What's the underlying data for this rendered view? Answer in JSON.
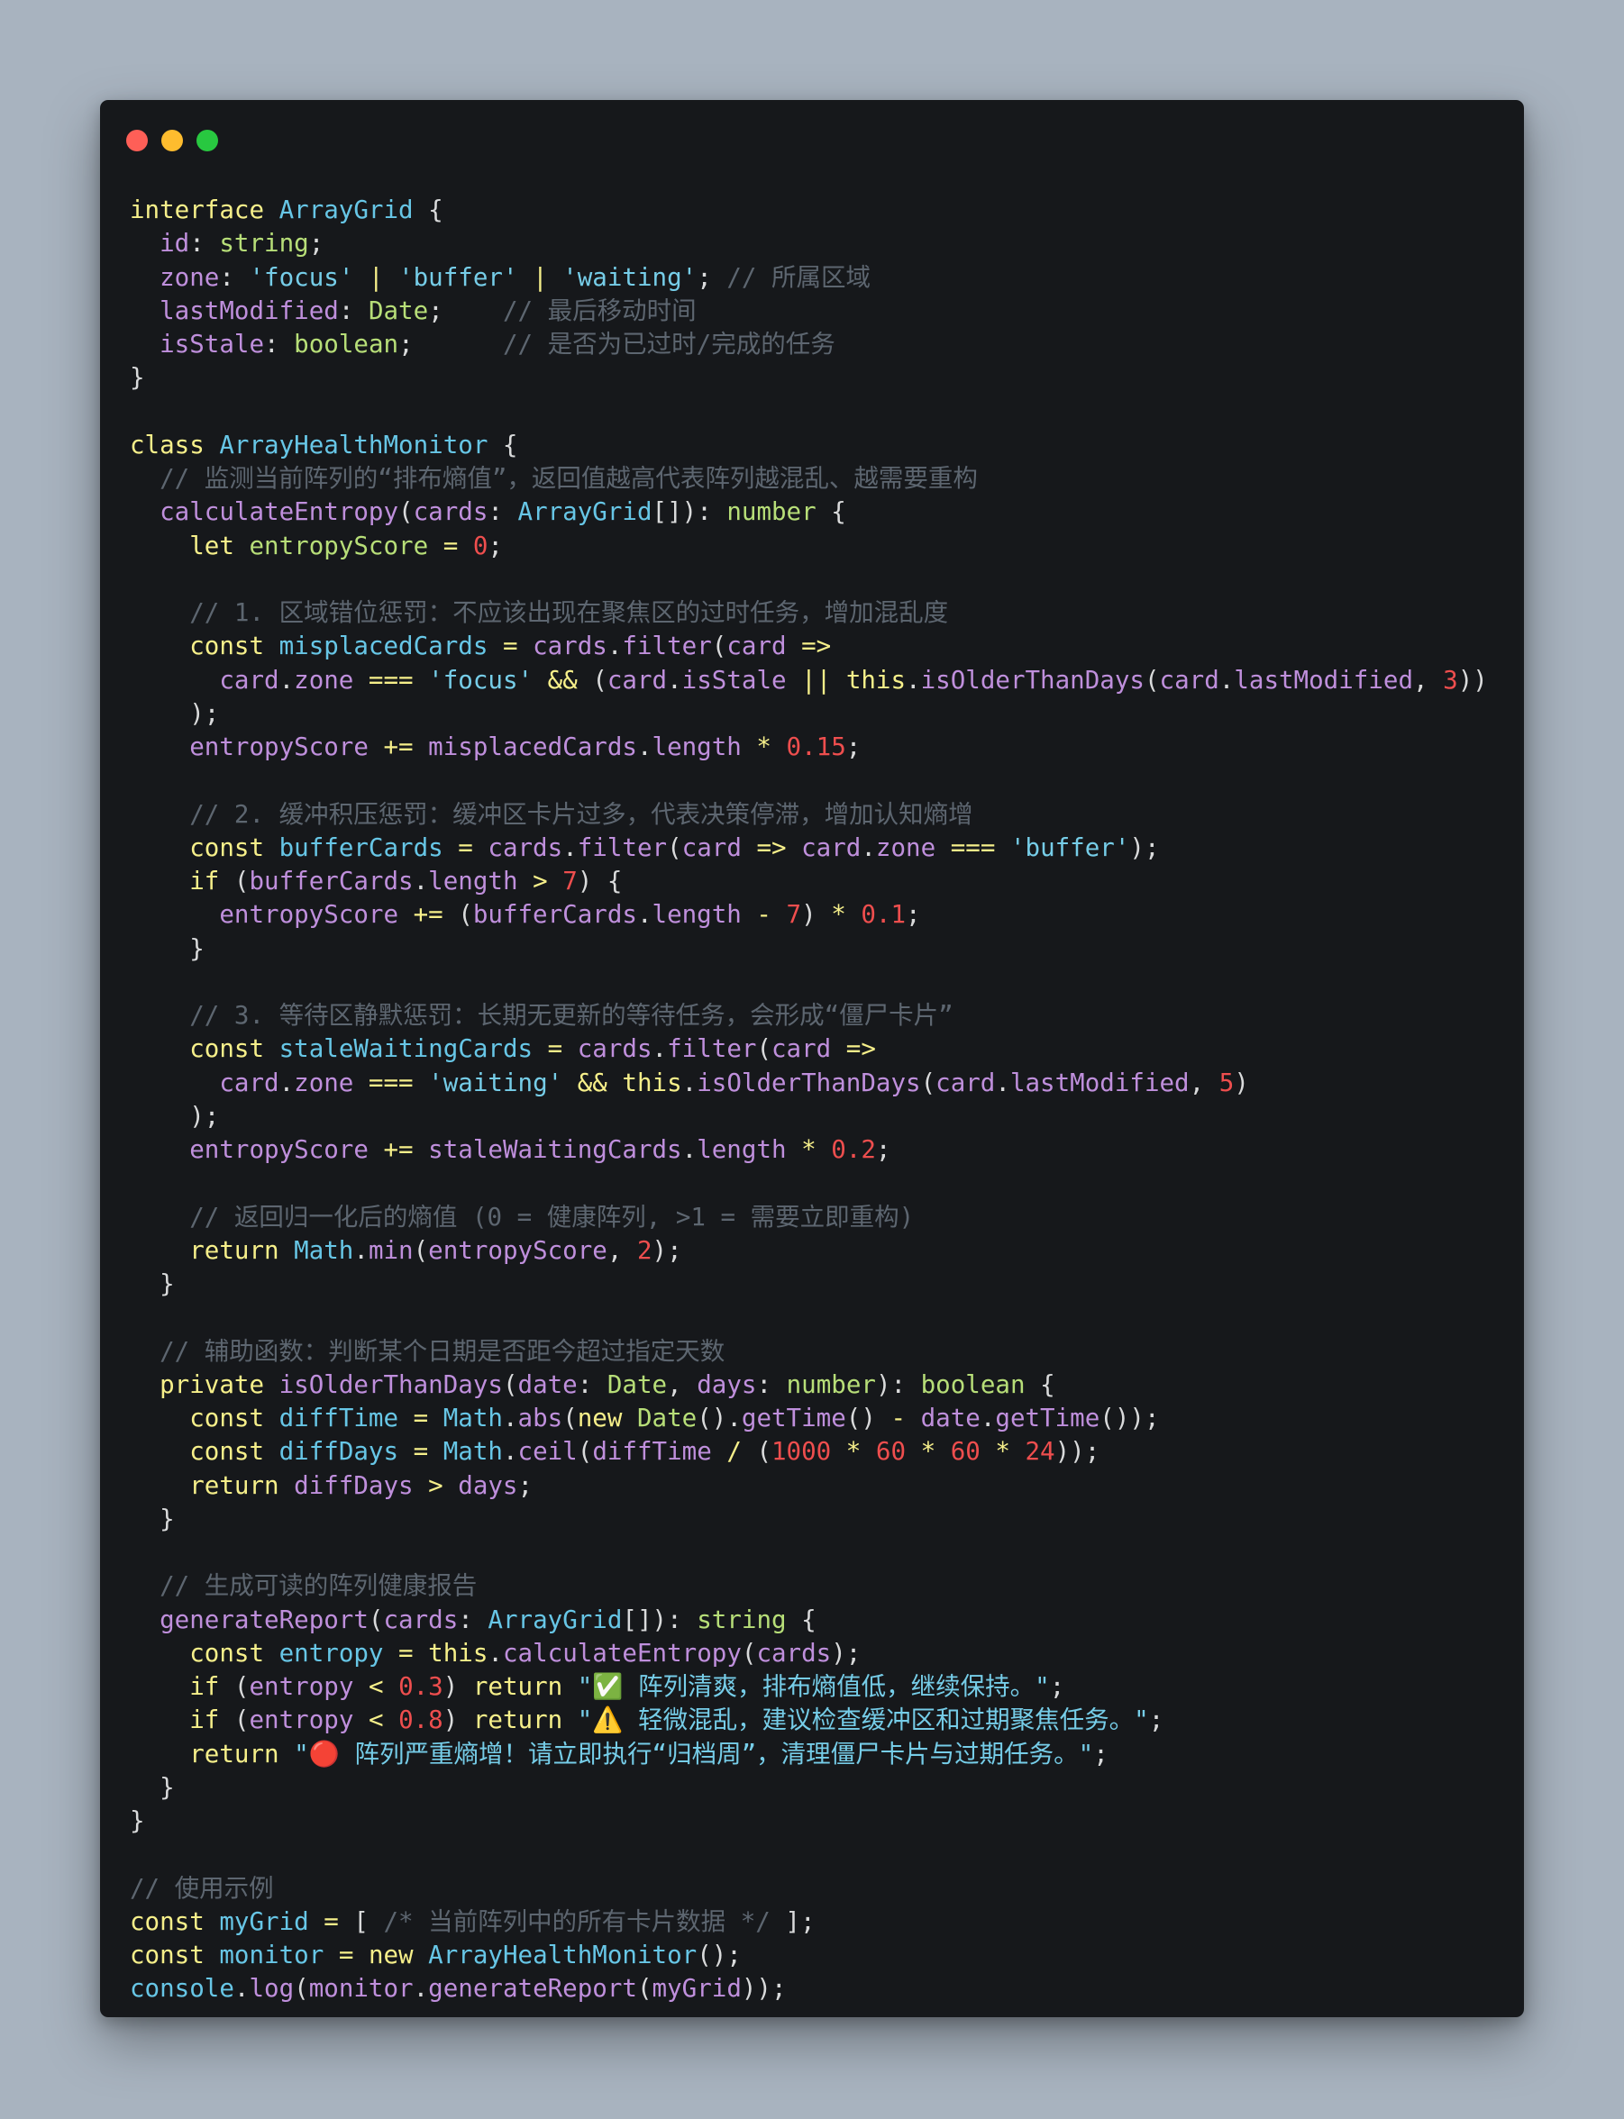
{
  "window": {
    "controls": [
      "close",
      "minimize",
      "maximize"
    ]
  },
  "code_lines": [
    [
      [
        "keyword",
        "interface"
      ],
      [
        "plain",
        " "
      ],
      [
        "type",
        "ArrayGrid"
      ],
      [
        "punct",
        " {"
      ]
    ],
    [
      [
        "plain",
        "  "
      ],
      [
        "prop",
        "id"
      ],
      [
        "punct",
        ": "
      ],
      [
        "prim",
        "string"
      ],
      [
        "punct",
        ";"
      ]
    ],
    [
      [
        "plain",
        "  "
      ],
      [
        "prop",
        "zone"
      ],
      [
        "punct",
        ": "
      ],
      [
        "string",
        "'focus'"
      ],
      [
        "operator",
        " | "
      ],
      [
        "string",
        "'buffer'"
      ],
      [
        "operator",
        " | "
      ],
      [
        "string",
        "'waiting'"
      ],
      [
        "punct",
        "; "
      ],
      [
        "comment",
        "// 所属区域"
      ]
    ],
    [
      [
        "plain",
        "  "
      ],
      [
        "prop",
        "lastModified"
      ],
      [
        "punct",
        ": "
      ],
      [
        "prim",
        "Date"
      ],
      [
        "punct",
        ";    "
      ],
      [
        "comment",
        "// 最后移动时间"
      ]
    ],
    [
      [
        "plain",
        "  "
      ],
      [
        "prop",
        "isStale"
      ],
      [
        "punct",
        ": "
      ],
      [
        "prim",
        "boolean"
      ],
      [
        "punct",
        ";      "
      ],
      [
        "comment",
        "// 是否为已过时/完成的任务"
      ]
    ],
    [
      [
        "punct",
        "}"
      ]
    ],
    [],
    [
      [
        "keyword",
        "class"
      ],
      [
        "plain",
        " "
      ],
      [
        "type",
        "ArrayHealthMonitor"
      ],
      [
        "punct",
        " {"
      ]
    ],
    [
      [
        "plain",
        "  "
      ],
      [
        "comment",
        "// 监测当前阵列的“排布熵值”，返回值越高代表阵列越混乱、越需要重构"
      ]
    ],
    [
      [
        "plain",
        "  "
      ],
      [
        "method",
        "calculateEntropy"
      ],
      [
        "punct",
        "("
      ],
      [
        "prop",
        "cards"
      ],
      [
        "punct",
        ": "
      ],
      [
        "type",
        "ArrayGrid"
      ],
      [
        "punct",
        "[]): "
      ],
      [
        "prim",
        "number"
      ],
      [
        "punct",
        " {"
      ]
    ],
    [
      [
        "plain",
        "    "
      ],
      [
        "keyword",
        "let"
      ],
      [
        "plain",
        " "
      ],
      [
        "prim",
        "entropyScore"
      ],
      [
        "operator",
        " = "
      ],
      [
        "number",
        "0"
      ],
      [
        "punct",
        ";"
      ]
    ],
    [],
    [
      [
        "plain",
        "    "
      ],
      [
        "comment",
        "// 1. 区域错位惩罚：不应该出现在聚焦区的过时任务，增加混乱度"
      ]
    ],
    [
      [
        "plain",
        "    "
      ],
      [
        "keyword",
        "const"
      ],
      [
        "plain",
        " "
      ],
      [
        "type",
        "misplacedCards"
      ],
      [
        "operator",
        " = "
      ],
      [
        "prop",
        "cards"
      ],
      [
        "punct",
        "."
      ],
      [
        "method",
        "filter"
      ],
      [
        "punct",
        "("
      ],
      [
        "prop",
        "card"
      ],
      [
        "operator",
        " =>"
      ]
    ],
    [
      [
        "plain",
        "      "
      ],
      [
        "prop",
        "card"
      ],
      [
        "punct",
        "."
      ],
      [
        "prop",
        "zone"
      ],
      [
        "operator",
        " === "
      ],
      [
        "string",
        "'focus'"
      ],
      [
        "operator",
        " && "
      ],
      [
        "punct",
        "("
      ],
      [
        "prop",
        "card"
      ],
      [
        "punct",
        "."
      ],
      [
        "prop",
        "isStale"
      ],
      [
        "operator",
        " || "
      ],
      [
        "keyword",
        "this"
      ],
      [
        "punct",
        "."
      ],
      [
        "method",
        "isOlderThanDays"
      ],
      [
        "punct",
        "("
      ],
      [
        "prop",
        "card"
      ],
      [
        "punct",
        "."
      ],
      [
        "prop",
        "lastModified"
      ],
      [
        "punct",
        ", "
      ],
      [
        "number",
        "3"
      ],
      [
        "punct",
        "))"
      ]
    ],
    [
      [
        "plain",
        "    "
      ],
      [
        "punct",
        ");"
      ]
    ],
    [
      [
        "plain",
        "    "
      ],
      [
        "prop",
        "entropyScore"
      ],
      [
        "operator",
        " += "
      ],
      [
        "prop",
        "misplacedCards"
      ],
      [
        "punct",
        "."
      ],
      [
        "prop",
        "length"
      ],
      [
        "operator",
        " * "
      ],
      [
        "number",
        "0.15"
      ],
      [
        "punct",
        ";"
      ]
    ],
    [],
    [
      [
        "plain",
        "    "
      ],
      [
        "comment",
        "// 2. 缓冲积压惩罚：缓冲区卡片过多，代表决策停滞，增加认知熵增"
      ]
    ],
    [
      [
        "plain",
        "    "
      ],
      [
        "keyword",
        "const"
      ],
      [
        "plain",
        " "
      ],
      [
        "type",
        "bufferCards"
      ],
      [
        "operator",
        " = "
      ],
      [
        "prop",
        "cards"
      ],
      [
        "punct",
        "."
      ],
      [
        "method",
        "filter"
      ],
      [
        "punct",
        "("
      ],
      [
        "prop",
        "card"
      ],
      [
        "operator",
        " => "
      ],
      [
        "prop",
        "card"
      ],
      [
        "punct",
        "."
      ],
      [
        "prop",
        "zone"
      ],
      [
        "operator",
        " === "
      ],
      [
        "string",
        "'buffer'"
      ],
      [
        "punct",
        ");"
      ]
    ],
    [
      [
        "plain",
        "    "
      ],
      [
        "keyword",
        "if"
      ],
      [
        "punct",
        " ("
      ],
      [
        "prop",
        "bufferCards"
      ],
      [
        "punct",
        "."
      ],
      [
        "prop",
        "length"
      ],
      [
        "operator",
        " > "
      ],
      [
        "number",
        "7"
      ],
      [
        "punct",
        ") {"
      ]
    ],
    [
      [
        "plain",
        "      "
      ],
      [
        "prop",
        "entropyScore"
      ],
      [
        "operator",
        " += "
      ],
      [
        "punct",
        "("
      ],
      [
        "prop",
        "bufferCards"
      ],
      [
        "punct",
        "."
      ],
      [
        "prop",
        "length"
      ],
      [
        "operator",
        " - "
      ],
      [
        "number",
        "7"
      ],
      [
        "punct",
        ")"
      ],
      [
        "operator",
        " * "
      ],
      [
        "number",
        "0.1"
      ],
      [
        "punct",
        ";"
      ]
    ],
    [
      [
        "plain",
        "    "
      ],
      [
        "punct",
        "}"
      ]
    ],
    [],
    [
      [
        "plain",
        "    "
      ],
      [
        "comment",
        "// 3. 等待区静默惩罚：长期无更新的等待任务，会形成“僵尸卡片”"
      ]
    ],
    [
      [
        "plain",
        "    "
      ],
      [
        "keyword",
        "const"
      ],
      [
        "plain",
        " "
      ],
      [
        "type",
        "staleWaitingCards"
      ],
      [
        "operator",
        " = "
      ],
      [
        "prop",
        "cards"
      ],
      [
        "punct",
        "."
      ],
      [
        "method",
        "filter"
      ],
      [
        "punct",
        "("
      ],
      [
        "prop",
        "card"
      ],
      [
        "operator",
        " =>"
      ]
    ],
    [
      [
        "plain",
        "      "
      ],
      [
        "prop",
        "card"
      ],
      [
        "punct",
        "."
      ],
      [
        "prop",
        "zone"
      ],
      [
        "operator",
        " === "
      ],
      [
        "string",
        "'waiting'"
      ],
      [
        "operator",
        " && "
      ],
      [
        "keyword",
        "this"
      ],
      [
        "punct",
        "."
      ],
      [
        "method",
        "isOlderThanDays"
      ],
      [
        "punct",
        "("
      ],
      [
        "prop",
        "card"
      ],
      [
        "punct",
        "."
      ],
      [
        "prop",
        "lastModified"
      ],
      [
        "punct",
        ", "
      ],
      [
        "number",
        "5"
      ],
      [
        "punct",
        ")"
      ]
    ],
    [
      [
        "plain",
        "    "
      ],
      [
        "punct",
        ");"
      ]
    ],
    [
      [
        "plain",
        "    "
      ],
      [
        "prop",
        "entropyScore"
      ],
      [
        "operator",
        " += "
      ],
      [
        "prop",
        "staleWaitingCards"
      ],
      [
        "punct",
        "."
      ],
      [
        "prop",
        "length"
      ],
      [
        "operator",
        " * "
      ],
      [
        "number",
        "0.2"
      ],
      [
        "punct",
        ";"
      ]
    ],
    [],
    [
      [
        "plain",
        "    "
      ],
      [
        "comment",
        "// 返回归一化后的熵值 (0 = 健康阵列, >1 = 需要立即重构)"
      ]
    ],
    [
      [
        "plain",
        "    "
      ],
      [
        "keyword",
        "return"
      ],
      [
        "plain",
        " "
      ],
      [
        "type",
        "Math"
      ],
      [
        "punct",
        "."
      ],
      [
        "method",
        "min"
      ],
      [
        "punct",
        "("
      ],
      [
        "prop",
        "entropyScore"
      ],
      [
        "punct",
        ", "
      ],
      [
        "number",
        "2"
      ],
      [
        "punct",
        ");"
      ]
    ],
    [
      [
        "plain",
        "  "
      ],
      [
        "punct",
        "}"
      ]
    ],
    [],
    [
      [
        "plain",
        "  "
      ],
      [
        "comment",
        "// 辅助函数：判断某个日期是否距今超过指定天数"
      ]
    ],
    [
      [
        "plain",
        "  "
      ],
      [
        "keyword",
        "private"
      ],
      [
        "plain",
        " "
      ],
      [
        "method",
        "isOlderThanDays"
      ],
      [
        "punct",
        "("
      ],
      [
        "prop",
        "date"
      ],
      [
        "punct",
        ": "
      ],
      [
        "prim",
        "Date"
      ],
      [
        "punct",
        ", "
      ],
      [
        "prop",
        "days"
      ],
      [
        "punct",
        ": "
      ],
      [
        "prim",
        "number"
      ],
      [
        "punct",
        "): "
      ],
      [
        "prim",
        "boolean"
      ],
      [
        "punct",
        " {"
      ]
    ],
    [
      [
        "plain",
        "    "
      ],
      [
        "keyword",
        "const"
      ],
      [
        "plain",
        " "
      ],
      [
        "type",
        "diffTime"
      ],
      [
        "operator",
        " = "
      ],
      [
        "type",
        "Math"
      ],
      [
        "punct",
        "."
      ],
      [
        "method",
        "abs"
      ],
      [
        "punct",
        "("
      ],
      [
        "keyword",
        "new"
      ],
      [
        "plain",
        " "
      ],
      [
        "prim",
        "Date"
      ],
      [
        "punct",
        "()."
      ],
      [
        "method",
        "getTime"
      ],
      [
        "punct",
        "()"
      ],
      [
        "operator",
        " - "
      ],
      [
        "prop",
        "date"
      ],
      [
        "punct",
        "."
      ],
      [
        "method",
        "getTime"
      ],
      [
        "punct",
        "());"
      ]
    ],
    [
      [
        "plain",
        "    "
      ],
      [
        "keyword",
        "const"
      ],
      [
        "plain",
        " "
      ],
      [
        "type",
        "diffDays"
      ],
      [
        "operator",
        " = "
      ],
      [
        "type",
        "Math"
      ],
      [
        "punct",
        "."
      ],
      [
        "method",
        "ceil"
      ],
      [
        "punct",
        "("
      ],
      [
        "prop",
        "diffTime"
      ],
      [
        "operator",
        " / "
      ],
      [
        "punct",
        "("
      ],
      [
        "number",
        "1000"
      ],
      [
        "operator",
        " * "
      ],
      [
        "number",
        "60"
      ],
      [
        "operator",
        " * "
      ],
      [
        "number",
        "60"
      ],
      [
        "operator",
        " * "
      ],
      [
        "number",
        "24"
      ],
      [
        "punct",
        "));"
      ]
    ],
    [
      [
        "plain",
        "    "
      ],
      [
        "keyword",
        "return"
      ],
      [
        "plain",
        " "
      ],
      [
        "prop",
        "diffDays"
      ],
      [
        "operator",
        " > "
      ],
      [
        "prop",
        "days"
      ],
      [
        "punct",
        ";"
      ]
    ],
    [
      [
        "plain",
        "  "
      ],
      [
        "punct",
        "}"
      ]
    ],
    [],
    [
      [
        "plain",
        "  "
      ],
      [
        "comment",
        "// 生成可读的阵列健康报告"
      ]
    ],
    [
      [
        "plain",
        "  "
      ],
      [
        "method",
        "generateReport"
      ],
      [
        "punct",
        "("
      ],
      [
        "prop",
        "cards"
      ],
      [
        "punct",
        ": "
      ],
      [
        "type",
        "ArrayGrid"
      ],
      [
        "punct",
        "[]): "
      ],
      [
        "prim",
        "string"
      ],
      [
        "punct",
        " {"
      ]
    ],
    [
      [
        "plain",
        "    "
      ],
      [
        "keyword",
        "const"
      ],
      [
        "plain",
        " "
      ],
      [
        "type",
        "entropy"
      ],
      [
        "operator",
        " = "
      ],
      [
        "keyword",
        "this"
      ],
      [
        "punct",
        "."
      ],
      [
        "method",
        "calculateEntropy"
      ],
      [
        "punct",
        "("
      ],
      [
        "prop",
        "cards"
      ],
      [
        "punct",
        ");"
      ]
    ],
    [
      [
        "plain",
        "    "
      ],
      [
        "keyword",
        "if"
      ],
      [
        "punct",
        " ("
      ],
      [
        "prop",
        "entropy"
      ],
      [
        "operator",
        " < "
      ],
      [
        "number",
        "0.3"
      ],
      [
        "punct",
        ") "
      ],
      [
        "keyword",
        "return"
      ],
      [
        "plain",
        " "
      ],
      [
        "string",
        "\""
      ],
      [
        "emoji",
        "✅"
      ],
      [
        "string",
        " 阵列清爽，排布熵值低，继续保持。\""
      ],
      [
        "punct",
        ";"
      ]
    ],
    [
      [
        "plain",
        "    "
      ],
      [
        "keyword",
        "if"
      ],
      [
        "punct",
        " ("
      ],
      [
        "prop",
        "entropy"
      ],
      [
        "operator",
        " < "
      ],
      [
        "number",
        "0.8"
      ],
      [
        "punct",
        ") "
      ],
      [
        "keyword",
        "return"
      ],
      [
        "plain",
        " "
      ],
      [
        "string",
        "\""
      ],
      [
        "emoji",
        "⚠️"
      ],
      [
        "string",
        " 轻微混乱，建议检查缓冲区和过期聚焦任务。\""
      ],
      [
        "punct",
        ";"
      ]
    ],
    [
      [
        "plain",
        "    "
      ],
      [
        "keyword",
        "return"
      ],
      [
        "plain",
        " "
      ],
      [
        "string",
        "\""
      ],
      [
        "emoji",
        "🔴"
      ],
      [
        "string",
        " 阵列严重熵增！请立即执行“归档周”，清理僵尸卡片与过期任务。\""
      ],
      [
        "punct",
        ";"
      ]
    ],
    [
      [
        "plain",
        "  "
      ],
      [
        "punct",
        "}"
      ]
    ],
    [
      [
        "punct",
        "}"
      ]
    ],
    [],
    [
      [
        "comment",
        "// 使用示例"
      ]
    ],
    [
      [
        "keyword",
        "const"
      ],
      [
        "plain",
        " "
      ],
      [
        "type",
        "myGrid"
      ],
      [
        "operator",
        " = "
      ],
      [
        "punct",
        "[ "
      ],
      [
        "comment",
        "/* 当前阵列中的所有卡片数据 */"
      ],
      [
        "punct",
        " ];"
      ]
    ],
    [
      [
        "keyword",
        "const"
      ],
      [
        "plain",
        " "
      ],
      [
        "type",
        "monitor"
      ],
      [
        "operator",
        " = "
      ],
      [
        "keyword",
        "new"
      ],
      [
        "plain",
        " "
      ],
      [
        "type",
        "ArrayHealthMonitor"
      ],
      [
        "punct",
        "();"
      ]
    ],
    [
      [
        "type",
        "console"
      ],
      [
        "punct",
        "."
      ],
      [
        "method",
        "log"
      ],
      [
        "punct",
        "("
      ],
      [
        "prop",
        "monitor"
      ],
      [
        "punct",
        "."
      ],
      [
        "method",
        "generateReport"
      ],
      [
        "punct",
        "("
      ],
      [
        "prop",
        "myGrid"
      ],
      [
        "punct",
        "));"
      ]
    ]
  ]
}
